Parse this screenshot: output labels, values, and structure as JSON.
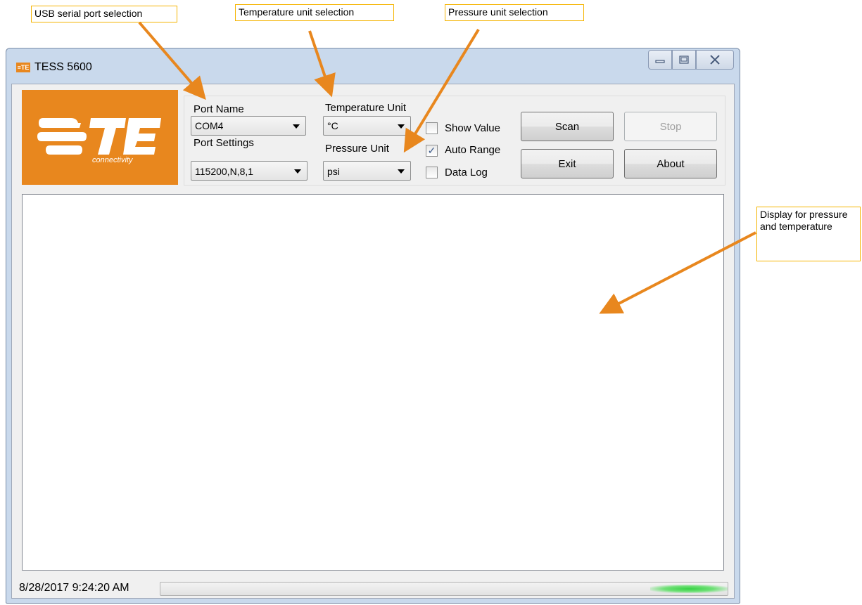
{
  "annotations": {
    "usb_port": "USB serial port selection",
    "temperature_unit": "Temperature unit selection",
    "pressure_unit": "Pressure unit selection",
    "display": "Display for pressure and temperature"
  },
  "window": {
    "title": "TESS 5600",
    "icon": "te-logo-icon",
    "controls": [
      "minimize-icon",
      "maximize-icon",
      "close-icon"
    ]
  },
  "logo": {
    "brand": "TE",
    "sub": "connectivity",
    "color": "#e8871e"
  },
  "port": {
    "name_label": "Port Name",
    "name_value": "COM4",
    "settings_label": "Port Settings",
    "settings_value": "115200,N,8,1"
  },
  "units": {
    "temperature_label": "Temperature Unit",
    "temperature_value": "°C",
    "pressure_label": "Pressure Unit",
    "pressure_value": "psi"
  },
  "options": [
    {
      "label": "Show Value",
      "checked": false
    },
    {
      "label": "Auto Range",
      "checked": true
    },
    {
      "label": "Data Log",
      "checked": false
    }
  ],
  "buttons": {
    "scan": "Scan",
    "stop": "Stop",
    "exit": "Exit",
    "about": "About"
  },
  "status": {
    "timestamp": "8/28/2017 9:24:20 AM",
    "progress_color": "#37d244"
  }
}
